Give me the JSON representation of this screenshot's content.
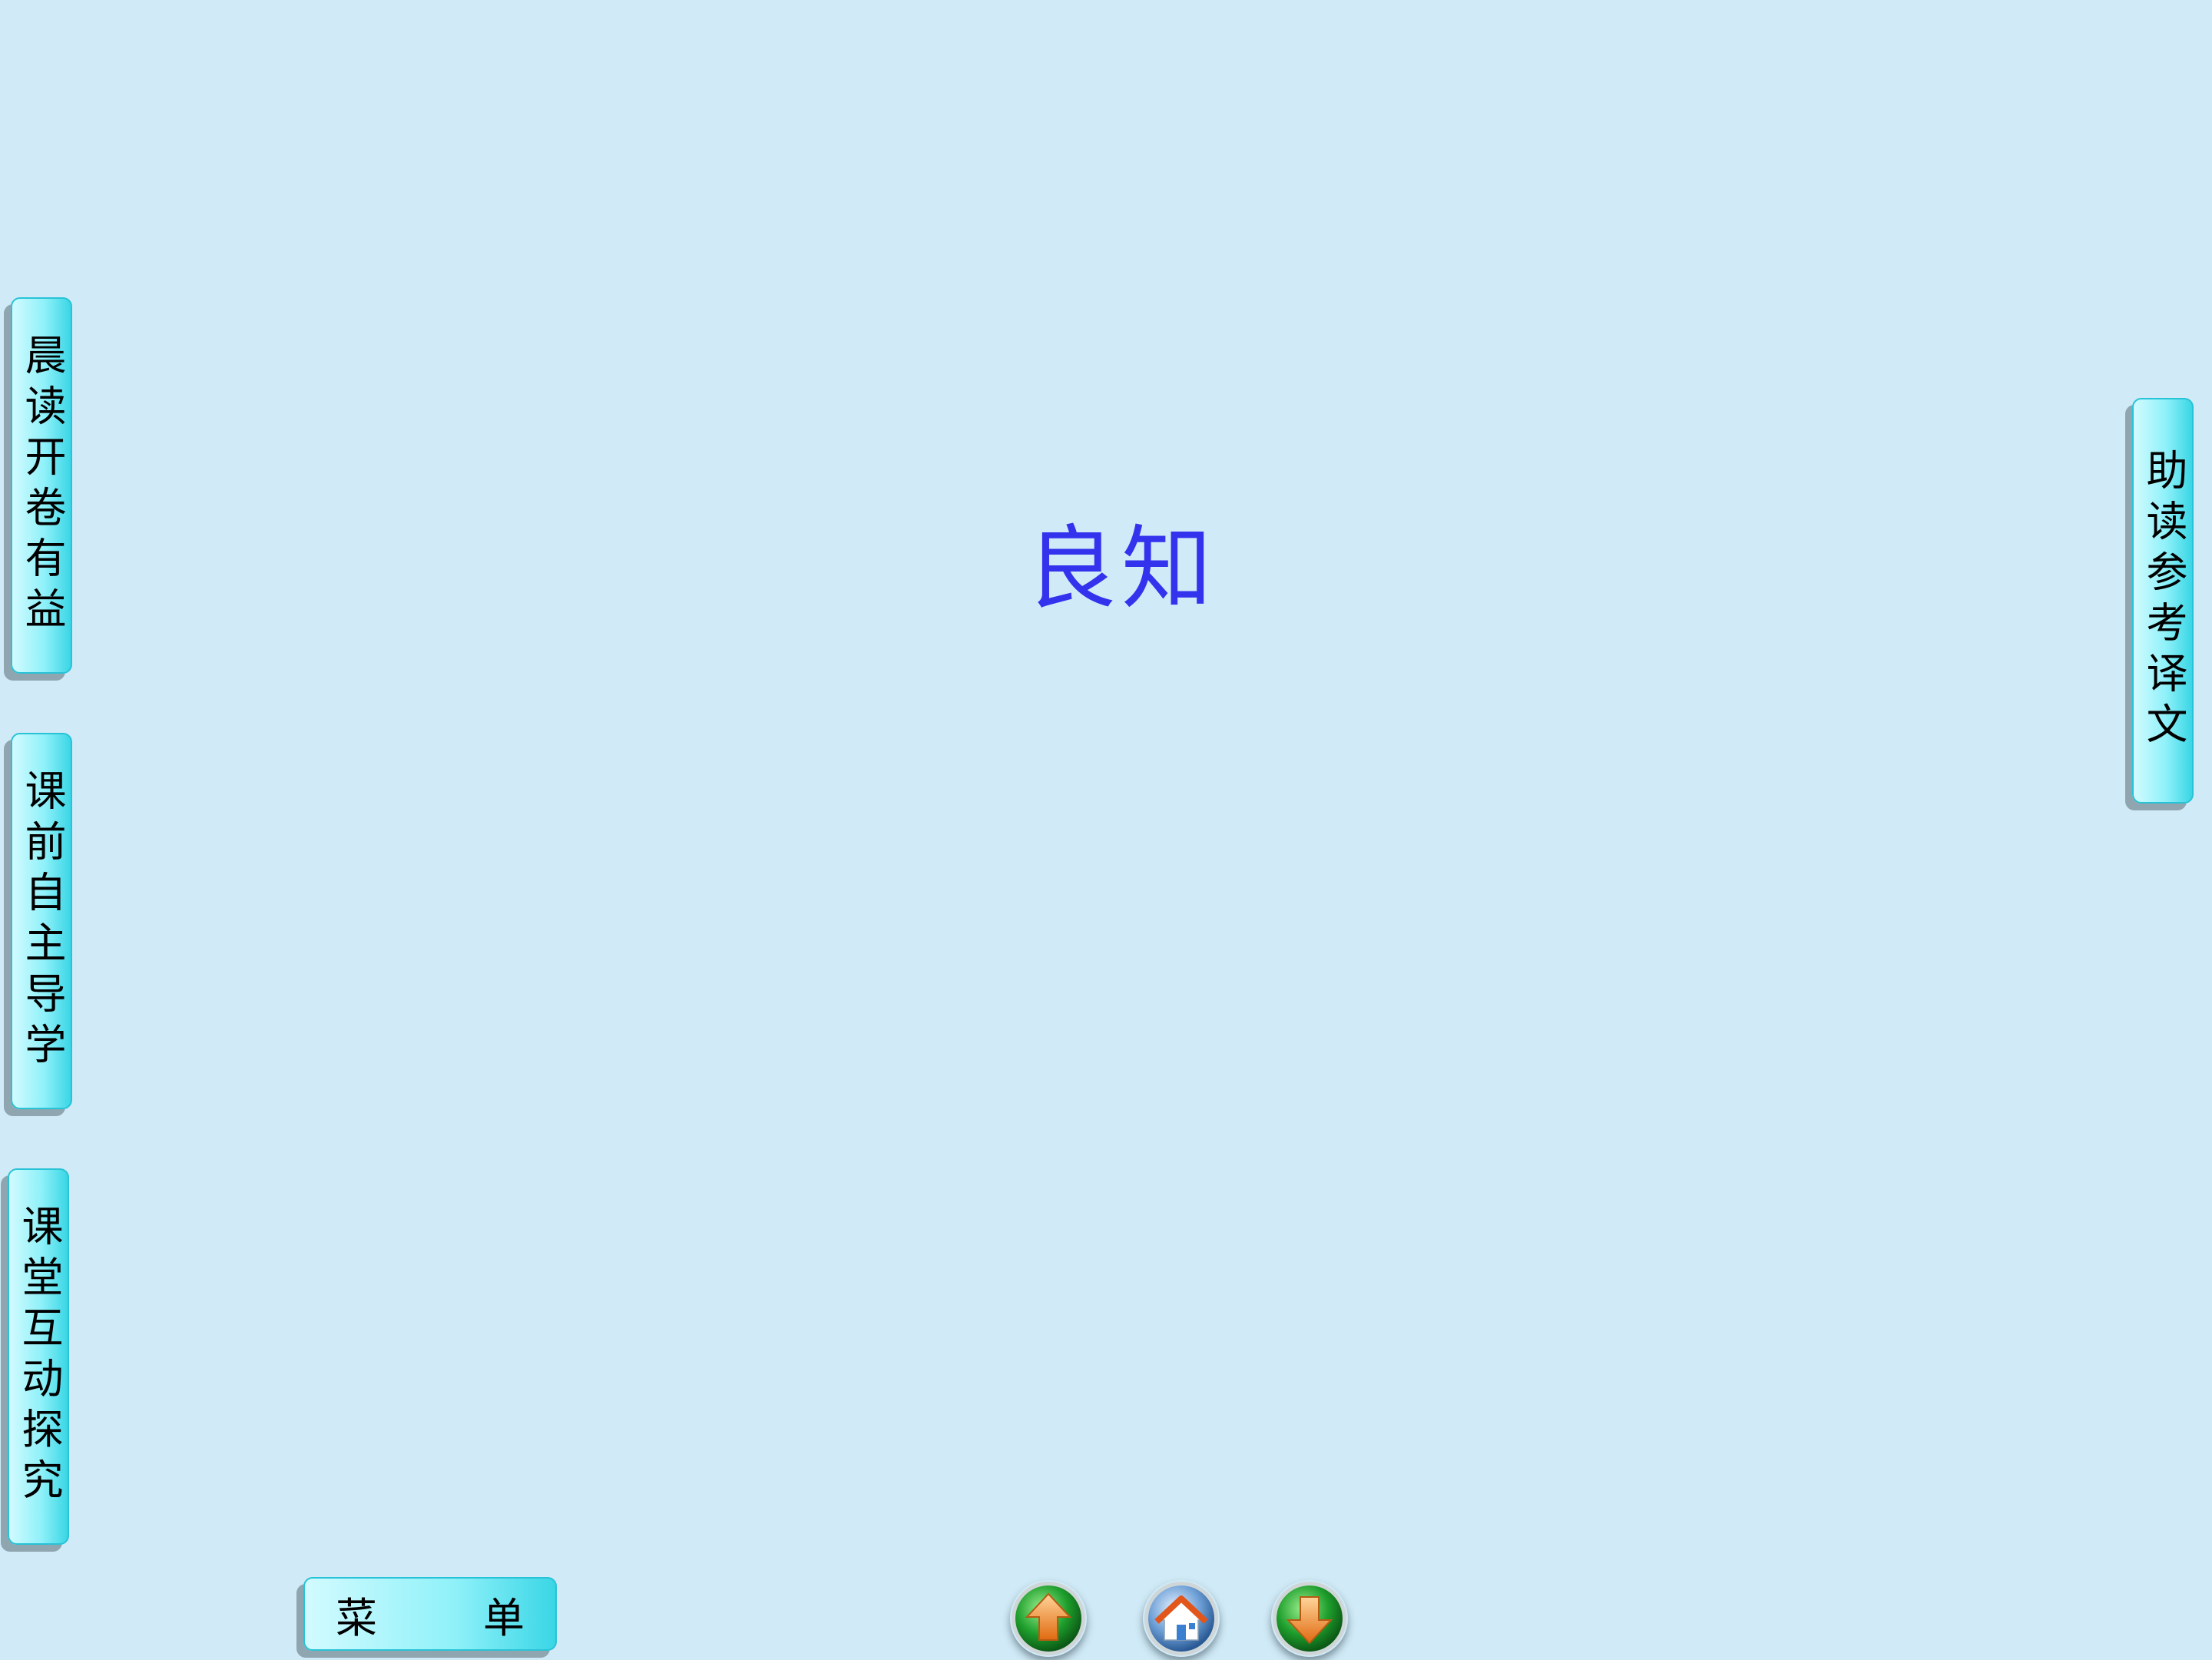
{
  "title": "良知",
  "left_tabs": [
    {
      "label": "晨读开卷有益"
    },
    {
      "label": "课前自主导学"
    },
    {
      "label": "课堂互动探究"
    }
  ],
  "right_tab": {
    "label": "助读参考译文"
  },
  "menu": {
    "char1": "菜",
    "char2": "单"
  },
  "nav": {
    "up_icon": "up-arrow-icon",
    "home_icon": "home-icon",
    "down_icon": "down-arrow-icon"
  },
  "colors": {
    "background": "#d0eaf7",
    "title": "#3333ee",
    "tab_accent": "#27c3d6",
    "nav_green": "#1e9e2c",
    "nav_orange": "#f08a2a"
  }
}
